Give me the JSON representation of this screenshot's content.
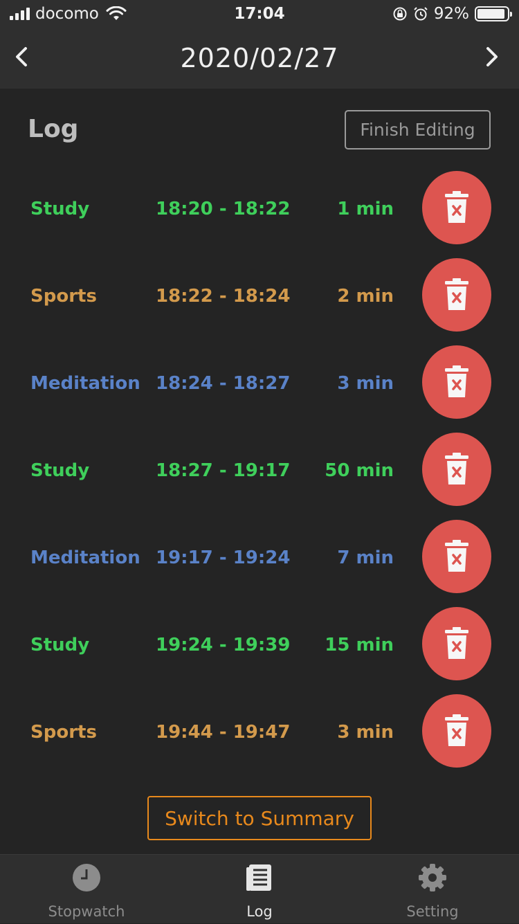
{
  "status_bar": {
    "carrier": "docomo",
    "time": "17:04",
    "battery_percent": "92%",
    "battery_level": 0.92
  },
  "nav": {
    "date": "2020/02/27",
    "prev_icon": "chevron-left-icon",
    "next_icon": "chevron-right-icon"
  },
  "section": {
    "title": "Log",
    "finish_editing_label": "Finish Editing"
  },
  "colors": {
    "Study": "#3fcf5b",
    "Sports": "#d39a4c",
    "Meditation": "#5a82c8",
    "delete": "#dd5550",
    "accent": "#e8891c"
  },
  "log_entries": [
    {
      "category": "Study",
      "range": "18:20 - 18:22",
      "duration": "1 min"
    },
    {
      "category": "Sports",
      "range": "18:22 - 18:24",
      "duration": "2 min"
    },
    {
      "category": "Meditation",
      "range": "18:24 - 18:27",
      "duration": "3 min"
    },
    {
      "category": "Study",
      "range": "18:27 - 19:17",
      "duration": "50 min"
    },
    {
      "category": "Meditation",
      "range": "19:17 - 19:24",
      "duration": "7 min"
    },
    {
      "category": "Study",
      "range": "19:24 - 19:39",
      "duration": "15 min"
    },
    {
      "category": "Sports",
      "range": "19:44 - 19:47",
      "duration": "3 min"
    }
  ],
  "switch_button_label": "Switch to Summary",
  "tabs": [
    {
      "label": "Stopwatch",
      "icon": "clock-icon",
      "active": false
    },
    {
      "label": "Log",
      "icon": "document-icon",
      "active": true
    },
    {
      "label": "Setting",
      "icon": "gear-icon",
      "active": false
    }
  ]
}
